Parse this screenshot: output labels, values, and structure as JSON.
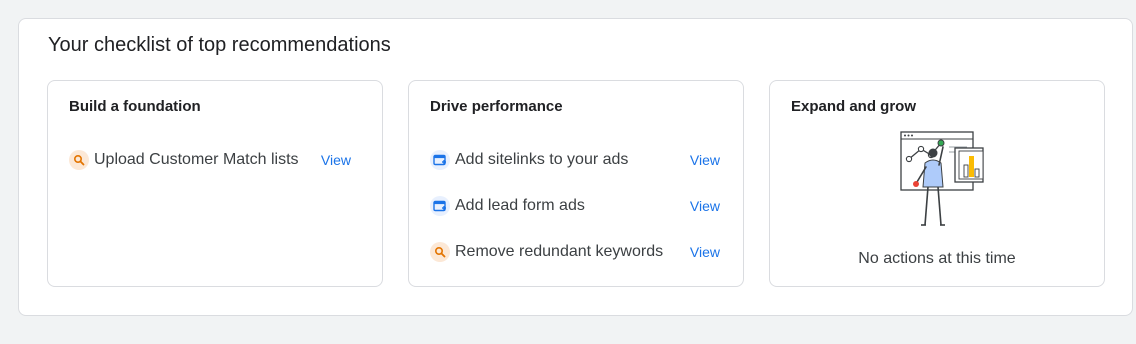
{
  "checklist": {
    "title": "Your checklist of top recommendations",
    "cards": [
      {
        "title": "Build a foundation",
        "items": [
          {
            "icon": "search-icon",
            "label": "Upload Customer Match lists",
            "action": "View"
          }
        ]
      },
      {
        "title": "Drive performance",
        "items": [
          {
            "icon": "ad-extension-icon",
            "label": "Add sitelinks to your ads",
            "action": "View"
          },
          {
            "icon": "ad-extension-icon",
            "label": "Add lead form ads",
            "action": "View"
          },
          {
            "icon": "search-icon",
            "label": "Remove redundant keywords",
            "action": "View"
          }
        ]
      },
      {
        "title": "Expand and grow",
        "empty_illustration": "person-with-charts-illustration",
        "empty_text": "No actions at this time"
      }
    ]
  },
  "colors": {
    "link": "#1a73e8",
    "search_icon_bg": "#fce8d6",
    "search_icon_fg": "#e37400",
    "ad_icon_bg": "#e8f0fe",
    "ad_icon_fg": "#1a73e8"
  }
}
